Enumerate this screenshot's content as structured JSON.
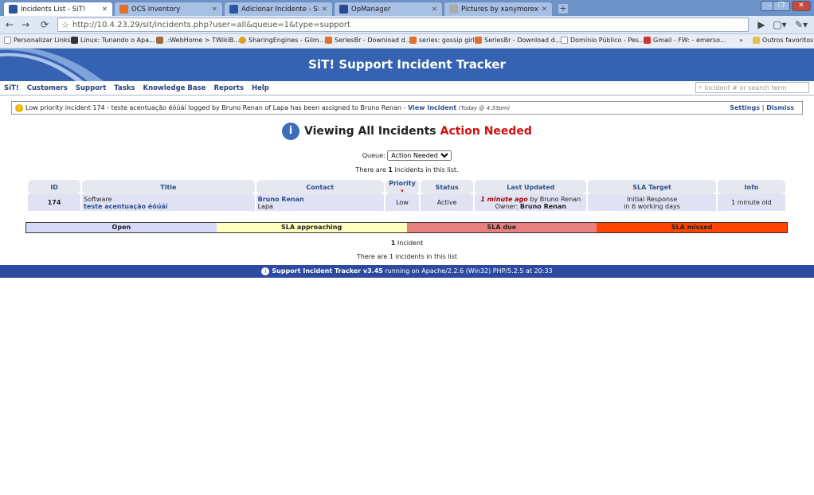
{
  "browser": {
    "tabs": [
      {
        "title": "Incidents List - SiT!",
        "active": true,
        "icon_color": "#2d56a0"
      },
      {
        "title": "OCS Inventory",
        "active": false,
        "icon_color": "#e0702a"
      },
      {
        "title": "Adicionar Incidente - SiT!",
        "active": false,
        "icon_color": "#2d56a0"
      },
      {
        "title": "OpManager",
        "active": false,
        "icon_color": "#2a4a8a"
      },
      {
        "title": "Pictures by xanymorex - P...",
        "active": false,
        "icon_color": "#aaaaaa"
      }
    ],
    "url": "http://10.4.23.29/sit/incidents.php?user=all&queue=1&type=support",
    "bookmarks": [
      {
        "label": "Personalizar Links",
        "icon_color": "#bbbbbb"
      },
      {
        "label": "Linux: Tunando o Apa...",
        "icon_color": "#333333"
      },
      {
        "label": ".:WebHome > TWikiB...",
        "icon_color": "#a06a3a"
      },
      {
        "label": "SharingEngines - Gilm...",
        "icon_color": "#e0a020"
      },
      {
        "label": "SeriesBr - Download d...",
        "icon_color": "#e0702a"
      },
      {
        "label": "series: gossip girl",
        "icon_color": "#e0702a"
      },
      {
        "label": "SeriesBr - Download d...",
        "icon_color": "#e0702a"
      },
      {
        "label": "Domínio Público - Pes...",
        "icon_color": "#bbbbbb"
      },
      {
        "label": "Gmail - FW: - emerso...",
        "icon_color": "#cc3333"
      }
    ],
    "other_bookmarks": "Outros favoritos"
  },
  "app": {
    "title": "SiT! Support Incident Tracker",
    "menu": [
      "SiT!",
      "Customers",
      "Support",
      "Tasks",
      "Knowledge Base",
      "Reports",
      "Help"
    ],
    "search_placeholder": "Incident # or search term"
  },
  "notice": {
    "text": "Low priority incident 174 - teste acentuação éóúáí logged by Bruno Renan of Lapa has been assigned to Bruno Renan -",
    "link": "View Incident",
    "time": "(Today @ 4:33pm)",
    "settings": "Settings",
    "separator": "|",
    "dismiss": "Dismiss"
  },
  "page": {
    "title": "Viewing All Incidents",
    "title_highlight": "Action Needed",
    "queue_label": "Queue:",
    "queue_value": "Action Needed",
    "count_prefix": "There are",
    "count_number": "1",
    "count_suffix": "incidents in this list."
  },
  "table": {
    "headers": [
      "ID",
      "Title",
      "Contact",
      "Priority",
      "Status",
      "Last Updated",
      "SLA Target",
      "Info"
    ],
    "rows": [
      {
        "id": "174",
        "title_top": "Software",
        "title_link": "teste acentuação éóúáí",
        "contact_name": "Bruno Renan",
        "contact_org": "Lapa",
        "priority": "Low",
        "status": "Active",
        "updated_ago": "1 minute ago",
        "updated_by": "by Bruno Renan",
        "owner_label": "Owner:",
        "owner": "Bruno Renan",
        "sla_line1": "Initial Response",
        "sla_line2": "in 6 working days",
        "info": "1 minute old"
      }
    ]
  },
  "legend": [
    {
      "label": "Open",
      "color": "#d8d8f8"
    },
    {
      "label": "SLA approaching",
      "color": "#ffffc0"
    },
    {
      "label": "SLA due",
      "color": "#e88080"
    },
    {
      "label": "SLA missed",
      "color": "#ff4400"
    }
  ],
  "summary": {
    "count": "1",
    "count_label": "Incident",
    "line": "There are 1 incidents in this list"
  },
  "footer": {
    "name": "Support Incident Tracker v3.45",
    "rest": "running on Apache/2.2.6 (Win32) PHP/5.2.5 at 20:33"
  }
}
